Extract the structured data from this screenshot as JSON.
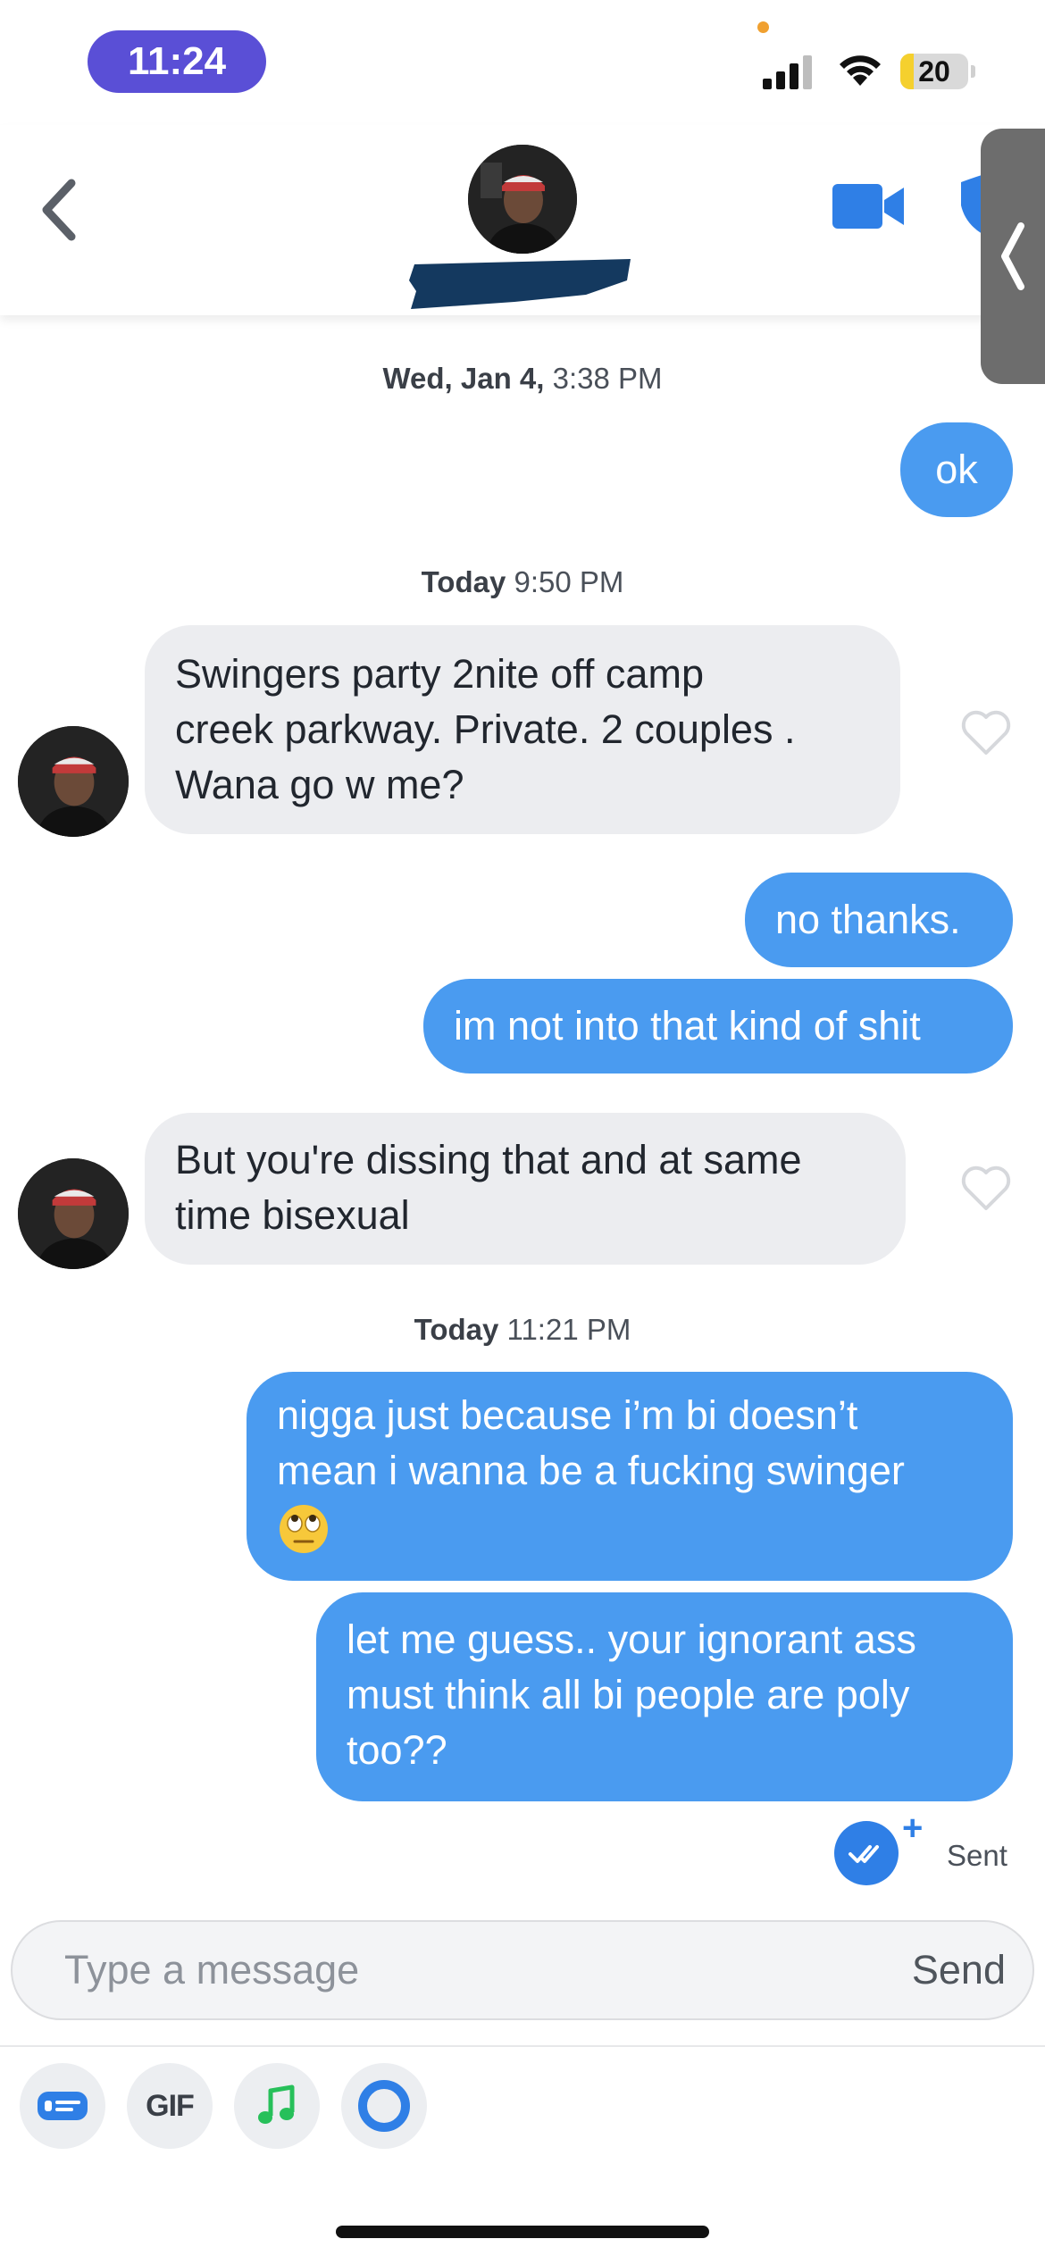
{
  "status_bar": {
    "time": "11:24",
    "battery_level": "20",
    "battery_fraction": 0.2,
    "signal_bars": 4,
    "wifi_icon": "wifi-icon"
  },
  "header": {
    "back_icon": "chevron-left-icon",
    "video_icon": "video-camera-icon",
    "safety_icon": "shield-icon",
    "side_tab_icon": "chevron-left-icon",
    "accent_color": "#2f7fe6"
  },
  "conversation": {
    "timestamps": [
      {
        "day": "Wed, Jan 4,",
        "time": "3:38 PM"
      },
      {
        "day": "Today",
        "time": "9:50 PM"
      },
      {
        "day": "Today",
        "time": "11:21 PM"
      }
    ],
    "messages": [
      {
        "direction": "outgoing",
        "text": "ok"
      },
      {
        "direction": "incoming",
        "lines": [
          "Swingers party 2nite off camp",
          "creek parkway. Private. 2 couples .",
          "Wana go w me?"
        ]
      },
      {
        "direction": "outgoing",
        "text": "no thanks."
      },
      {
        "direction": "outgoing",
        "text": "im not into that kind of shit"
      },
      {
        "direction": "incoming",
        "lines": [
          "But you're dissing that and at same",
          "time bisexual"
        ]
      },
      {
        "direction": "outgoing",
        "lines": [
          "nigga just because i’m bi doesn’t",
          "mean i wanna be a fucking swinger"
        ],
        "emoji": "eye-roll-emoji"
      },
      {
        "direction": "outgoing",
        "lines": [
          "let me guess.. your ignorant ass",
          "must think all bi people are poly",
          "too??"
        ]
      }
    ],
    "sent_status": "Sent",
    "outgoing_color": "#4a9bf0",
    "incoming_color": "#ecedf0"
  },
  "composer": {
    "placeholder": "Type a message",
    "send_label": "Send"
  },
  "toolbar": {
    "gif_label": "GIF",
    "items": [
      "contact-card-icon",
      "gif-icon",
      "music-note-icon",
      "ring-icon"
    ]
  }
}
